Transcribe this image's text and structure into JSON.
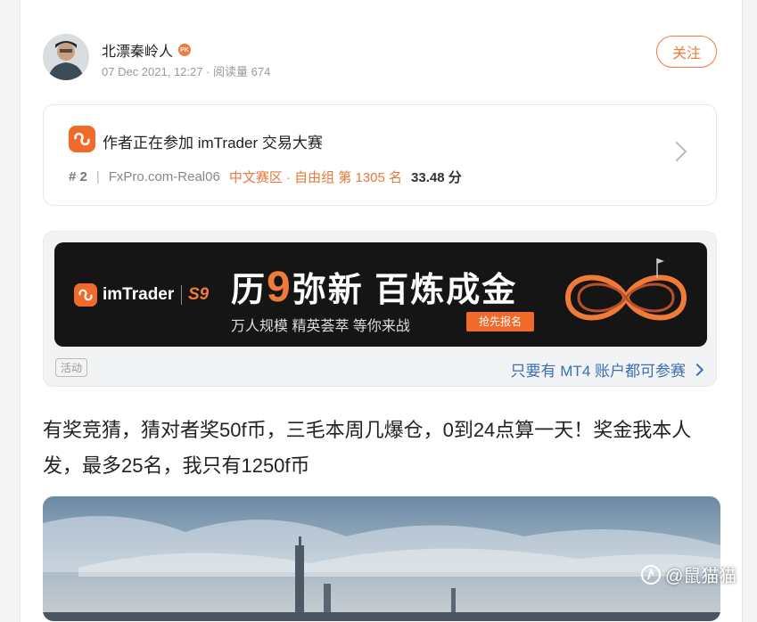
{
  "post": {
    "author": "北漂秦岭人",
    "meta": "07 Dec 2021, 12:27 · 阅读量 674",
    "follow_label": "关注"
  },
  "contest": {
    "title": "作者正在参加 imTrader 交易大赛",
    "rank": "# 2",
    "account": "FxPro.com-Real06",
    "zone": "中文赛区 · 自由组 第 1305 名",
    "score": "33.48 分"
  },
  "ad": {
    "brand": "imTrader",
    "season": "S9",
    "headline_a": "历",
    "headline_nine": "9",
    "headline_b": "弥新 百炼成金",
    "subline": "万人规模  精英荟萃  等你来战",
    "cta": "抢先报名",
    "tag": "活动",
    "link": "只要有 MT4 账户都可参赛"
  },
  "body": {
    "text": "有奖竞猜，猜对者奖50f币，三毛本周几爆仓，0到24点算一天！奖金我本人发，最多25名，我只有1250f币"
  },
  "watermark": "@鼠猫猫",
  "colors": {
    "accent": "#f07a3a",
    "link": "#3a6fb0"
  }
}
